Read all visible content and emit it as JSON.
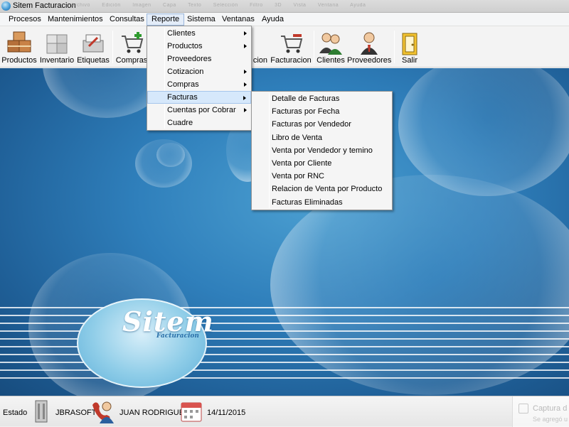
{
  "window": {
    "title": "Sitem Facturacion",
    "ghost_menu": [
      "Archivo",
      "Edición",
      "Imagen",
      "Capa",
      "Texto",
      "Selección",
      "Filtro",
      "3D",
      "Vista",
      "Ventana",
      "Ayuda"
    ]
  },
  "menubar": {
    "items": [
      "Procesos",
      "Mantenimientos",
      "Consultas",
      "Reporte",
      "Sistema",
      "Ventanas",
      "Ayuda"
    ],
    "open_item": "Reporte"
  },
  "toolbar": {
    "buttons": [
      "Productos",
      "Inventario",
      "Etiquetas",
      "Compras",
      "Cotizacion",
      "Facturacion",
      "Clientes",
      "Proveedores",
      "Salir"
    ],
    "partial_label": "cion"
  },
  "reporte_menu": {
    "items": [
      {
        "label": "Clientes",
        "has_submenu": true
      },
      {
        "label": "Productos",
        "has_submenu": true
      },
      {
        "label": "Proveedores",
        "has_submenu": false
      },
      {
        "label": "Cotizacion",
        "has_submenu": true
      },
      {
        "label": "Compras",
        "has_submenu": true
      },
      {
        "label": "Facturas",
        "has_submenu": true,
        "active": true
      },
      {
        "label": "Cuentas por Cobrar",
        "has_submenu": true
      },
      {
        "label": "Cuadre",
        "has_submenu": false
      }
    ]
  },
  "facturas_submenu": {
    "items": [
      "Detalle de Facturas",
      "Facturas por Fecha",
      "Facturas por Vendedor",
      "Libro de Venta",
      "Venta por Vendedor y temino",
      "Venta por Cliente",
      "Venta por RNC",
      "Relacion de Venta por Producto",
      "Facturas Eliminadas"
    ]
  },
  "logo": {
    "name": "Sitem",
    "tagline": "Facturacion"
  },
  "statusbar": {
    "estado_label": "Estado",
    "company": "JBRASOFT",
    "user": "JUAN RODRIGUEZ",
    "date": "14/11/2015",
    "toast_title": "Captura d",
    "toast_sub": "Se agregó u"
  },
  "colors": {
    "desktop_blue": "#2f7fbb",
    "menu_highlight": "#d6e8fb"
  }
}
